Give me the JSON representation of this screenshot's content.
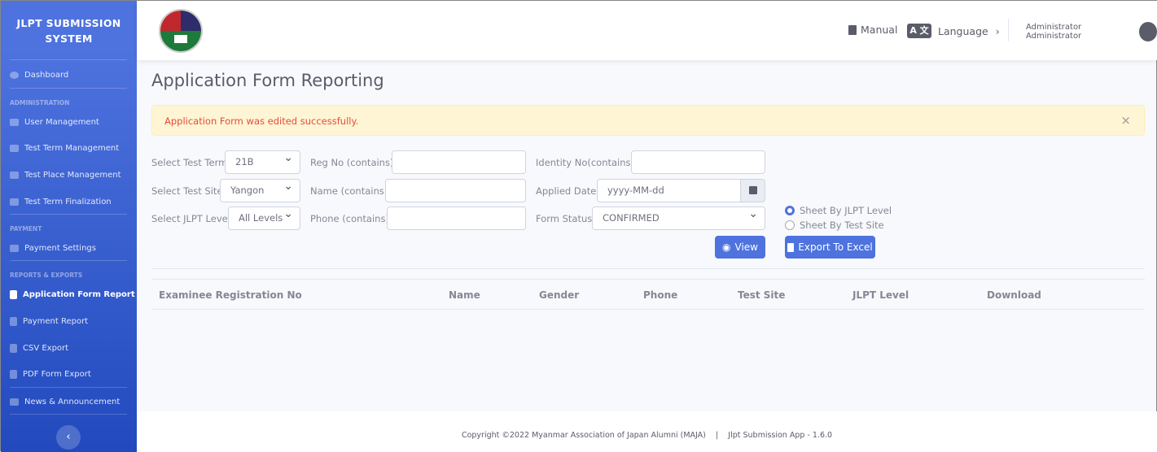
{
  "sidebar": {
    "brand": "JLPT SUBMISSION SYSTEM",
    "dashboard": "Dashboard",
    "sections": {
      "admin": "ADMINISTRATION",
      "payment": "PAYMENT",
      "reports": "REPORTS & EXPORTS"
    },
    "items": {
      "user": "User Management",
      "term": "Test Term Management",
      "place": "Test Place Management",
      "final": "Test Term Finalization",
      "paysettings": "Payment Settings",
      "appreport": "Application Form Report",
      "payreport": "Payment Report",
      "csv": "CSV Export",
      "pdf": "PDF Form Export",
      "news": "News & Announcement"
    },
    "active": "Application Form Report",
    "collapse_icon": "chevron-left-icon"
  },
  "topbar": {
    "manual": "Manual",
    "language": "Language",
    "user": "Administrator Administrator"
  },
  "page": {
    "title": "Application Form Reporting",
    "alert": "Application Form was edited successfully.",
    "alert_close": "×",
    "filters": {
      "term_label": "Select Test Term",
      "term_value": "21B",
      "site_label": "Select Test Site",
      "site_value": "Yangon",
      "level_label": "Select JLPT Level",
      "level_value": "All Levels",
      "reg_label": "Reg No (contains)",
      "name_label": "Name (contains)",
      "phone_label": "Phone (contains)",
      "identity_label": "Identity No(contains)",
      "date_label": "Applied Date",
      "date_placeholder": "yyyy-MM-dd",
      "status_label": "Form Status",
      "status_value": "CONFIRMED"
    },
    "radios": [
      {
        "label": "Sheet By JLPT Level",
        "checked": true
      },
      {
        "label": "Sheet By Test Site",
        "checked": false
      }
    ],
    "view": "View",
    "export": "Export To Excel",
    "columns": [
      "Examinee Registration No",
      "Name",
      "Gender",
      "Phone",
      "Test Site",
      "JLPT Level",
      "Download"
    ]
  },
  "footer": {
    "copyright": "Copyright ©2022 Myanmar Association of Japan Alumni (MAJA)",
    "sep": "|",
    "app": "Jlpt Submission App - 1.6.0"
  },
  "colors": {
    "primary": "#4e73df",
    "alert_text": "#e74a3b",
    "alert_bg": "#fef5d4"
  }
}
